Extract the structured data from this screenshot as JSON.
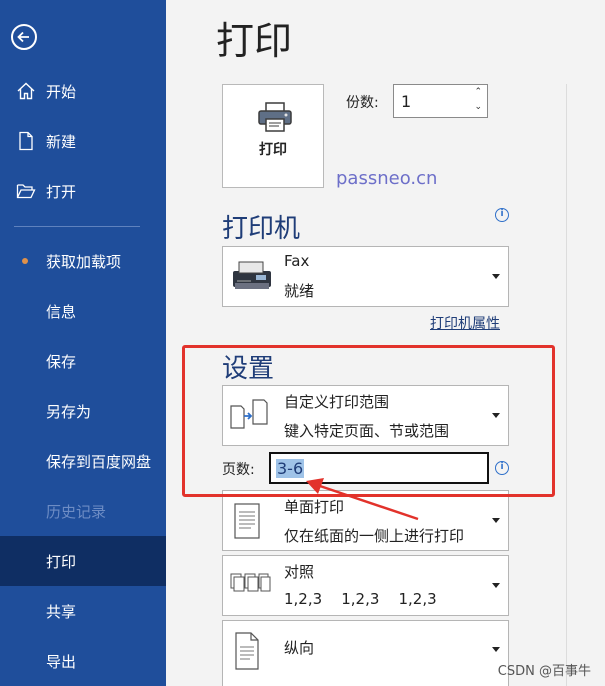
{
  "sidebar": {
    "items": [
      {
        "label": "开始"
      },
      {
        "label": "新建"
      },
      {
        "label": "打开"
      },
      {
        "label": "获取加载项"
      },
      {
        "label": "信息"
      },
      {
        "label": "保存"
      },
      {
        "label": "另存为"
      },
      {
        "label": "保存到百度网盘"
      },
      {
        "label": "历史记录"
      },
      {
        "label": "打印"
      },
      {
        "label": "共享"
      },
      {
        "label": "导出"
      }
    ]
  },
  "page_title": "打印",
  "print_button_label": "打印",
  "copies": {
    "label": "份数:",
    "value": "1"
  },
  "watermark": "passneo.cn",
  "printer": {
    "heading": "打印机",
    "name": "Fax",
    "status": "就绪",
    "properties_link": "打印机属性"
  },
  "settings": {
    "heading": "设置",
    "range": {
      "title": "自定义打印范围",
      "subtitle": "键入特定页面、节或范围"
    },
    "pages_label": "页数:",
    "pages_value": "3-6",
    "sides": {
      "title": "单面打印",
      "subtitle": "仅在纸面的一侧上进行打印"
    },
    "collate": {
      "title": "对照",
      "subtitle": "1,2,3    1,2,3    1,2,3"
    },
    "orientation": {
      "title": "纵向"
    }
  },
  "footer_watermark": "CSDN @百事牛",
  "colors": {
    "sidebar": "#1f4e9b",
    "sidebar_active": "#0f2e63",
    "accent": "#1f3d78",
    "highlight_box": "#e2322b"
  }
}
